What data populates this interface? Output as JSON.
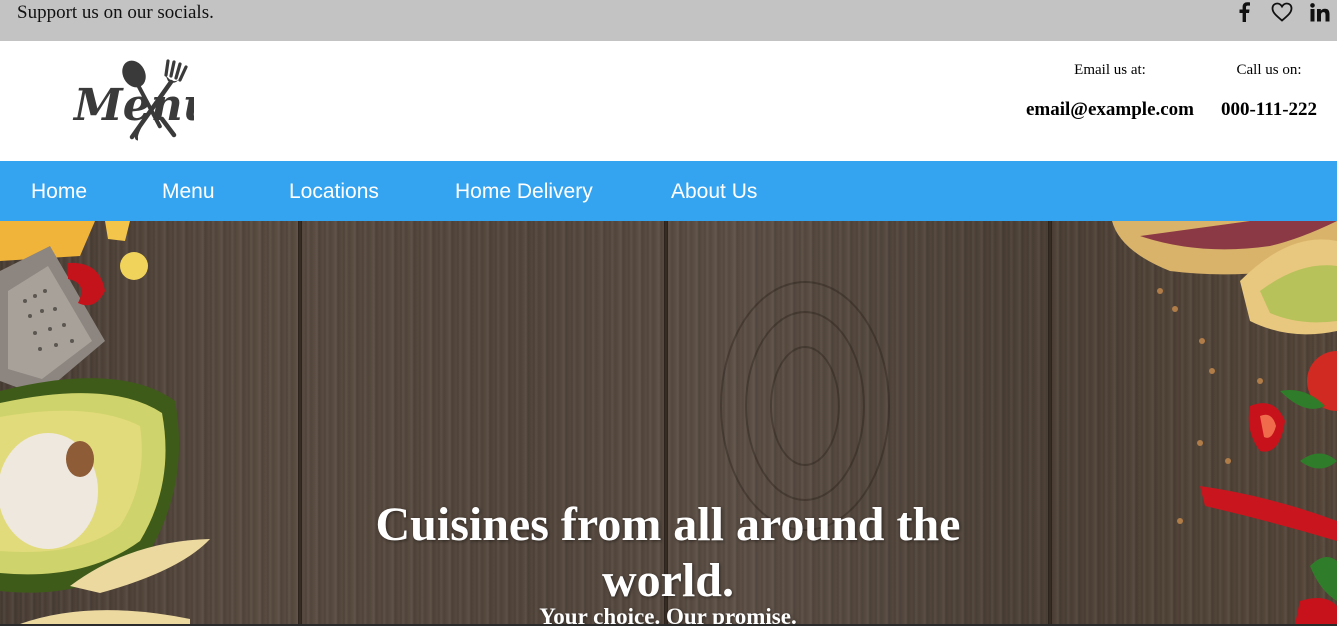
{
  "topbar": {
    "text": "Support us on our socials.",
    "social_icons": [
      "facebook-icon",
      "heart-icon",
      "linkedin-icon"
    ],
    "background": "#c3c3c3"
  },
  "header": {
    "logo_text": "Menu",
    "email": {
      "label": "Email us at:",
      "value": "email@example.com"
    },
    "phone": {
      "label": "Call us on:",
      "value": "000-111-222"
    }
  },
  "nav": {
    "background": "#35a4f0",
    "items": [
      {
        "label": "Home"
      },
      {
        "label": "Menu"
      },
      {
        "label": "Locations"
      },
      {
        "label": "Home Delivery"
      },
      {
        "label": "About Us"
      }
    ]
  },
  "hero": {
    "title": "Cuisines from all around the world.",
    "subtitle": "Your choice. Our promise."
  }
}
